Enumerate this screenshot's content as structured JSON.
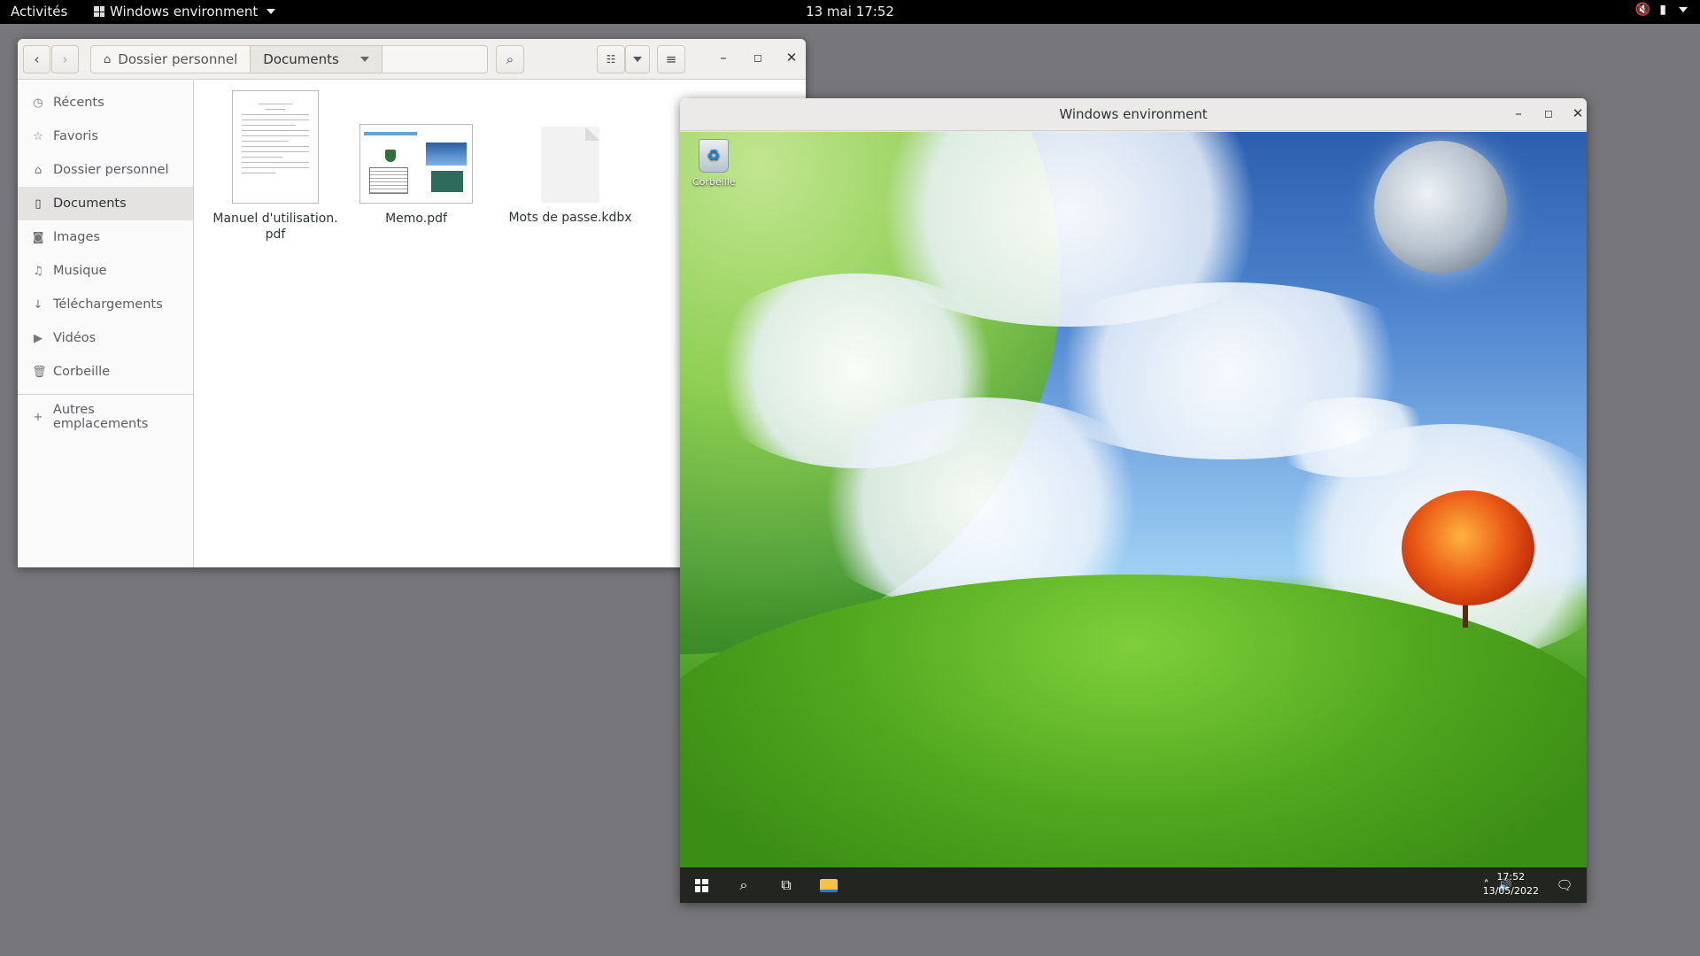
{
  "topbar": {
    "activities": "Activités",
    "app_name": "Windows environment",
    "clock": "13 mai  17:52",
    "tray": {
      "volume_icon": "volume-muted-icon",
      "battery_icon": "battery-icon",
      "menu_icon": "system-menu-caret-icon"
    }
  },
  "files_window": {
    "path": {
      "home": "Dossier personnel",
      "current": "Documents"
    },
    "sidebar": {
      "items": [
        {
          "label": "Récents",
          "icon": "clock-icon"
        },
        {
          "label": "Favoris",
          "icon": "star-icon"
        },
        {
          "label": "Dossier personnel",
          "icon": "home-icon"
        },
        {
          "label": "Documents",
          "icon": "document-icon",
          "active": true
        },
        {
          "label": "Images",
          "icon": "camera-icon"
        },
        {
          "label": "Musique",
          "icon": "music-icon"
        },
        {
          "label": "Téléchargements",
          "icon": "download-icon"
        },
        {
          "label": "Vidéos",
          "icon": "video-icon"
        },
        {
          "label": "Corbeille",
          "icon": "trash-icon"
        }
      ],
      "other": "Autres emplacements"
    },
    "files": [
      {
        "name_line1": "Manuel d'utilisation.",
        "name_line2": "pdf",
        "type": "pdf-thumbnail"
      },
      {
        "name_line1": "Memo.pdf",
        "name_line2": "",
        "type": "pdf-thumbnail"
      },
      {
        "name_line1": "Mots de passe.kdbx",
        "name_line2": "",
        "type": "generic-file"
      }
    ]
  },
  "windows_window": {
    "title": "Windows environment",
    "desktop_icon": "Corbeille",
    "taskbar": {
      "time": "17:52",
      "date": "13/05/2022"
    }
  },
  "colors": {
    "desktop_bg": "#77767b",
    "topbar_bg": "#000000",
    "sidebar_active": "#e4e3e1"
  }
}
